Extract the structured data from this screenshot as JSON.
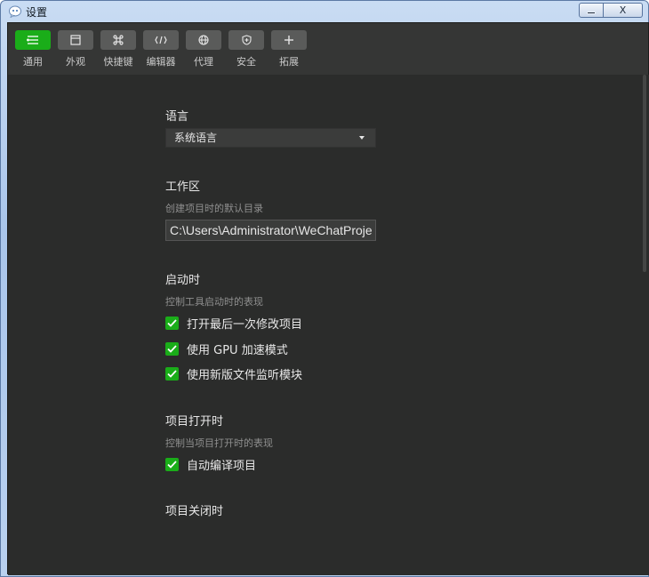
{
  "window": {
    "title": "设置",
    "close_glyph": "X"
  },
  "toolbar": {
    "items": [
      {
        "label": "通用",
        "icon": "list-settings-icon",
        "active": true
      },
      {
        "label": "外观",
        "icon": "window-icon",
        "active": false
      },
      {
        "label": "快捷键",
        "icon": "command-key-icon",
        "active": false
      },
      {
        "label": "编辑器",
        "icon": "code-icon",
        "active": false
      },
      {
        "label": "代理",
        "icon": "globe-icon",
        "active": false
      },
      {
        "label": "安全",
        "icon": "shield-icon",
        "active": false
      },
      {
        "label": "拓展",
        "icon": "plus-icon",
        "active": false
      }
    ]
  },
  "settings": {
    "language": {
      "title": "语言",
      "selected": "系统语言"
    },
    "workspace": {
      "title": "工作区",
      "desc": "创建项目时的默认目录",
      "path": "C:\\Users\\Administrator\\WeChatProjects"
    },
    "startup": {
      "title": "启动时",
      "desc": "控制工具启动时的表现",
      "options": [
        {
          "label": "打开最后一次修改项目",
          "checked": true
        },
        {
          "label": "使用 GPU 加速模式",
          "checked": true
        },
        {
          "label": "使用新版文件监听模块",
          "checked": true
        }
      ]
    },
    "project_open": {
      "title": "项目打开时",
      "desc": "控制当项目打开时的表现",
      "options": [
        {
          "label": "自动编译项目",
          "checked": true
        }
      ]
    },
    "project_close": {
      "title": "项目关闭时"
    }
  },
  "colors": {
    "accent": "#1aad19",
    "background": "#2b2c2b",
    "toolbar": "#353635"
  }
}
